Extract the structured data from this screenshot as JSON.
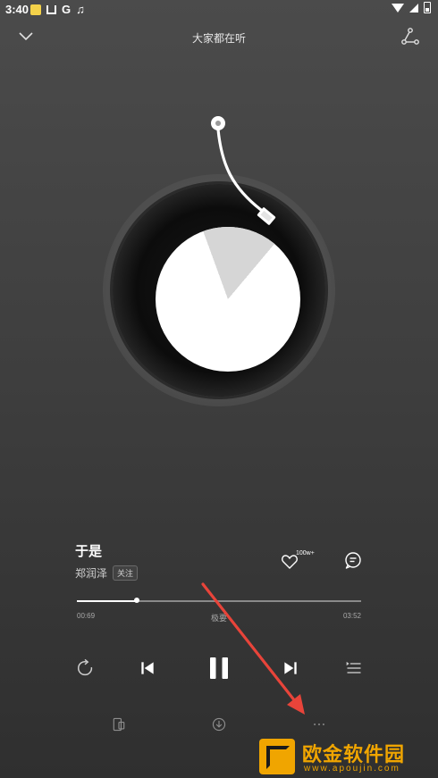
{
  "status_bar": {
    "time": "3:40",
    "notif_g": "G",
    "notif_music": "♫"
  },
  "header": {
    "title": "大家都在听"
  },
  "song": {
    "title": "于是",
    "artist": "郑润泽",
    "follow_label": "关注",
    "like_count": "100w+"
  },
  "progress": {
    "current_time": "00:69",
    "total_time": "03:52",
    "quality": "极要",
    "fraction": 0.21
  },
  "watermark": {
    "name": "欧金软件园",
    "url": "www.apoujin.com"
  },
  "colors": {
    "background_top": "#4b4b4b",
    "background_bottom": "#2f2f2f",
    "arrow": "#e8443a",
    "watermark": "#f0a500"
  }
}
